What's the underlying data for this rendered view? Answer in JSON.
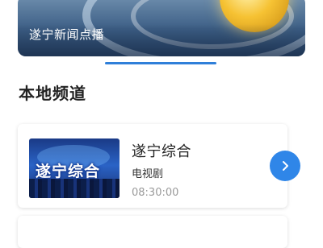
{
  "banner": {
    "caption": "遂宁新闻点播"
  },
  "section": {
    "title": "本地频道"
  },
  "channels": [
    {
      "thumbnail_text": "遂宁综合",
      "name": "遂宁综合",
      "type": "电视剧",
      "time": "08:30:00"
    }
  ],
  "colors": {
    "accent": "#2f86e8",
    "indicator": "#2f7fd9"
  },
  "icons": {
    "go": "chevron-right-icon"
  }
}
